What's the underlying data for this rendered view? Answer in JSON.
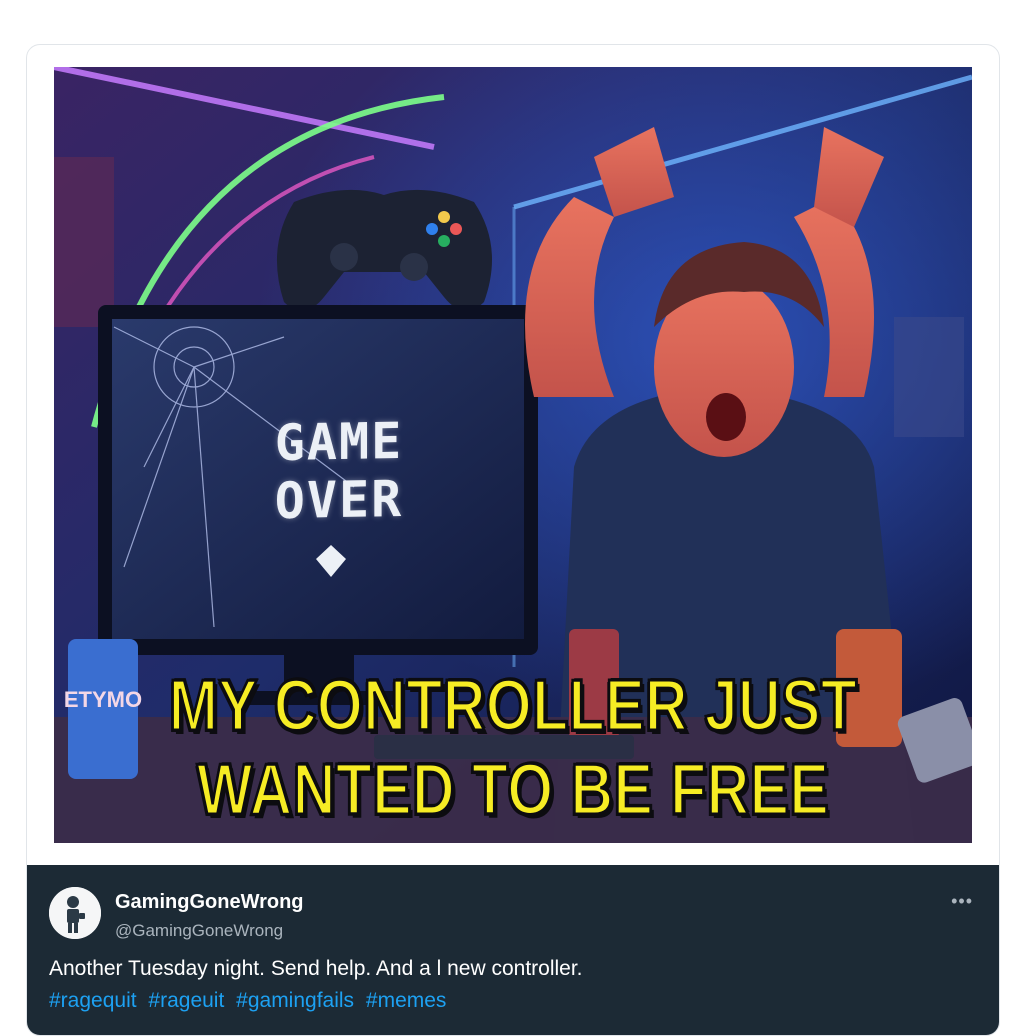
{
  "meme": {
    "screen_line1": "GAME",
    "screen_line2": "OVER",
    "caption_line1": "MY CONTROLLER JUST",
    "caption_line2": "WANTED TO BE FREE",
    "can_label": "ETYMO"
  },
  "post": {
    "display_name": "GamingGoneWrong",
    "handle": "@GamingGoneWrong",
    "text": "Another Tuesday night. Send help. And a l new controller.",
    "hashtags": [
      "#ragequit",
      "#rageuit",
      "#gamingfails",
      "#memes"
    ],
    "more_label": "•••"
  },
  "colors": {
    "footer_bg": "#1c2a35",
    "hashtag": "#1da1f2",
    "caption_fill": "#f6ec24"
  }
}
